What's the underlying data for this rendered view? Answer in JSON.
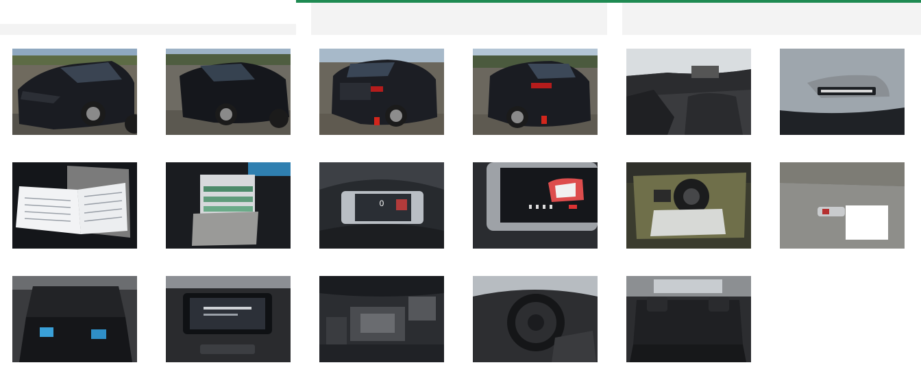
{
  "theme": {
    "accent": "#1e8a52",
    "header_bg": "#f3f3f3",
    "page_bg": "#ffffff"
  },
  "gallery": {
    "columns": [
      {
        "header_label": ""
      },
      {
        "header_label": ""
      },
      {
        "header_label": ""
      }
    ],
    "photos": [
      {
        "subject": "car-front-left-exterior"
      },
      {
        "subject": "car-front-right-exterior"
      },
      {
        "subject": "car-rear-left-exterior"
      },
      {
        "subject": "car-rear-right-exterior"
      },
      {
        "subject": "front-seats-interior"
      },
      {
        "subject": "windshield-vin-sticker"
      },
      {
        "subject": "owner-manual-booklet"
      },
      {
        "subject": "documents-folder"
      },
      {
        "subject": "instrument-cluster"
      },
      {
        "subject": "infotainment-screen-closeup"
      },
      {
        "subject": "spare-wheel-well"
      },
      {
        "subject": "car-key-on-carpet"
      },
      {
        "subject": "trunk-cargo-area"
      },
      {
        "subject": "dashboard-center-display"
      },
      {
        "subject": "engine-bay"
      },
      {
        "subject": "steering-wheel-cockpit"
      },
      {
        "subject": "rear-seat-bench"
      }
    ]
  }
}
